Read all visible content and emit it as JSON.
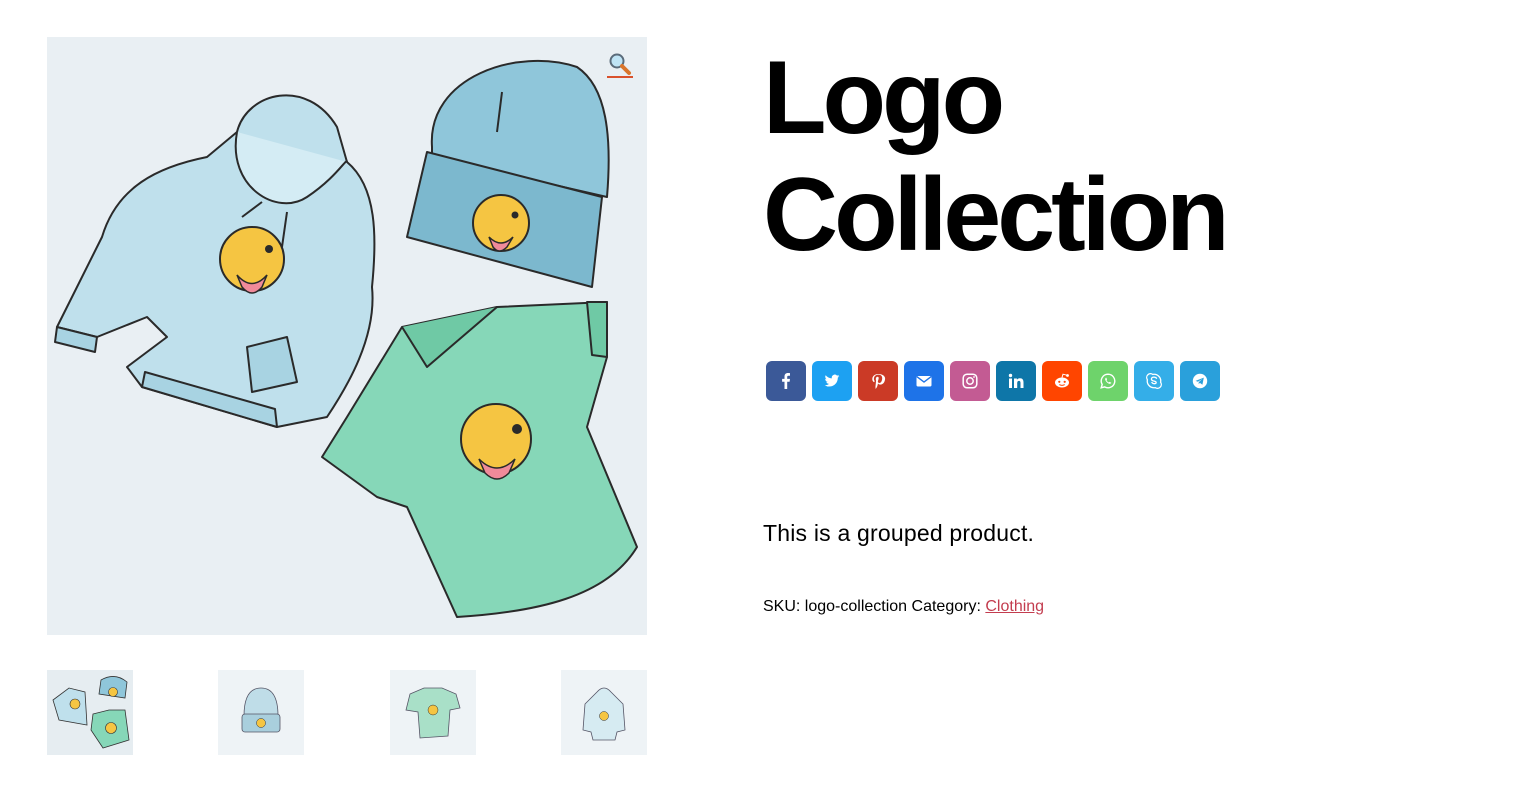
{
  "product": {
    "title_line1": "Logo",
    "title_line2": "Collection",
    "description": "This is a grouped product.",
    "sku_label": "SKU:",
    "sku_value": "logo-collection",
    "category_label": "Category:",
    "category_value": "Clothing"
  },
  "gallery": {
    "main_image_alt": "Hoodie, beanie and t-shirt illustration",
    "zoom_icon": "magnifier-icon",
    "thumbnails": [
      {
        "name": "thumbnail-logo-collection",
        "active": true
      },
      {
        "name": "thumbnail-beanie",
        "active": false
      },
      {
        "name": "thumbnail-tshirt",
        "active": false
      },
      {
        "name": "thumbnail-hoodie",
        "active": false
      }
    ]
  },
  "share_buttons": [
    {
      "network": "facebook",
      "icon": "facebook-icon",
      "color": "#3b5998"
    },
    {
      "network": "twitter",
      "icon": "twitter-icon",
      "color": "#1da1f2"
    },
    {
      "network": "pinterest",
      "icon": "pinterest-icon",
      "color": "#cb3a26"
    },
    {
      "network": "email",
      "icon": "envelope-icon",
      "color": "#1e73e8"
    },
    {
      "network": "instagram",
      "icon": "instagram-icon",
      "color": "#c35b93"
    },
    {
      "network": "linkedin",
      "icon": "linkedin-icon",
      "color": "#0e76a8"
    },
    {
      "network": "reddit",
      "icon": "reddit-icon",
      "color": "#ff4500"
    },
    {
      "network": "whatsapp",
      "icon": "whatsapp-icon",
      "color": "#6ed36b"
    },
    {
      "network": "skype",
      "icon": "skype-icon",
      "color": "#34aee8"
    },
    {
      "network": "telegram",
      "icon": "telegram-icon",
      "color": "#2aa0db"
    }
  ],
  "colors": {
    "link": "#c33d4f",
    "image_background": "#e9eff3",
    "hoodie": "#bfe0ec",
    "beanie": "#8fc6da",
    "tshirt": "#86d7b8",
    "emoji": "#f5c542"
  }
}
